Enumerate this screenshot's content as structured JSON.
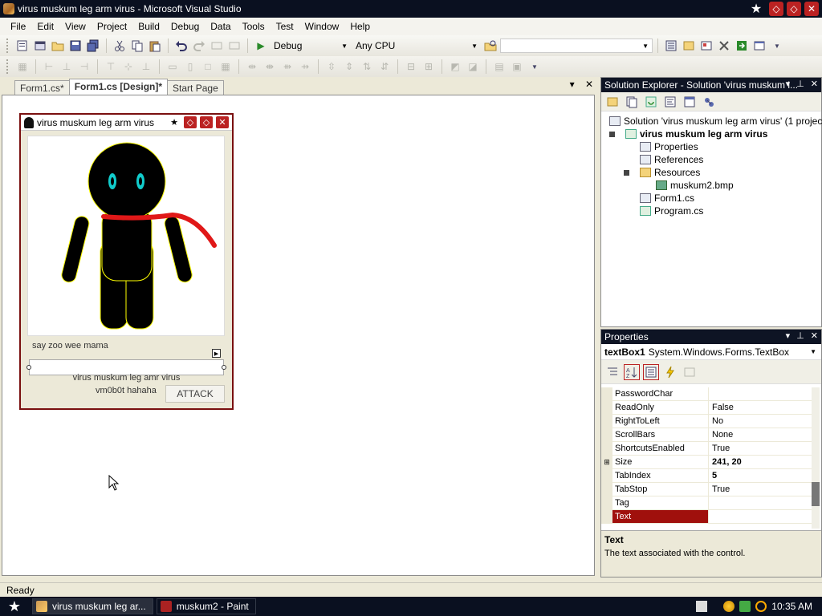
{
  "window": {
    "title": "virus muskum leg arm virus - Microsoft Visual Studio",
    "star": "★",
    "btn_restore": "◇",
    "btn_max": "◇",
    "btn_close": "✕"
  },
  "menu": [
    "File",
    "Edit",
    "View",
    "Project",
    "Build",
    "Debug",
    "Data",
    "Tools",
    "Test",
    "Window",
    "Help"
  ],
  "toolbar": {
    "config": "Debug",
    "platform": "Any CPU",
    "play": "▶"
  },
  "doc_tabs": {
    "tabs": [
      "Form1.cs*",
      "Form1.cs [Design]*",
      "Start Page"
    ],
    "pin": "▾",
    "close": "✕"
  },
  "form": {
    "title": "virus muskum leg arm virus",
    "label1": "say zoo wee mama",
    "label2": "virus muskum leg amr virus",
    "label3": "vm0b0t hahaha",
    "button": "ATTACK",
    "star": "★",
    "btn_min": "◇",
    "btn_max": "◇",
    "btn_close": "✕",
    "smart": "▶"
  },
  "solution_explorer": {
    "title": "Solution Explorer - Solution 'virus muskum l...",
    "pin": "▾",
    "pushpin": "⊥",
    "close": "✕",
    "items": [
      "Solution 'virus muskum leg arm virus' (1 project)",
      "virus muskum leg arm virus",
      "Properties",
      "References",
      "Resources",
      "muskum2.bmp",
      "Form1.cs",
      "Program.cs"
    ]
  },
  "properties": {
    "title": "Properties",
    "pin": "▾",
    "pushpin": "⊥",
    "close": "✕",
    "object_name": "textBox1",
    "object_type": "System.Windows.Forms.TextBox",
    "rows": [
      {
        "name": "PasswordChar",
        "value": "",
        "bold": false
      },
      {
        "name": "ReadOnly",
        "value": "False",
        "bold": false
      },
      {
        "name": "RightToLeft",
        "value": "No",
        "bold": false
      },
      {
        "name": "ScrollBars",
        "value": "None",
        "bold": false
      },
      {
        "name": "ShortcutsEnabled",
        "value": "True",
        "bold": false
      },
      {
        "name": "Size",
        "value": "241, 20",
        "bold": true,
        "expand": "⊞"
      },
      {
        "name": "TabIndex",
        "value": "5",
        "bold": true
      },
      {
        "name": "TabStop",
        "value": "True",
        "bold": false
      },
      {
        "name": "Tag",
        "value": "",
        "bold": false
      },
      {
        "name": "Text",
        "value": "",
        "bold": false
      }
    ],
    "desc_title": "Text",
    "desc_text": "The text associated with the control."
  },
  "status": "Ready",
  "taskbar": {
    "start": "★",
    "items": [
      "virus muskum leg ar...",
      "muskum2 - Paint"
    ],
    "clock": "10:35 AM"
  }
}
